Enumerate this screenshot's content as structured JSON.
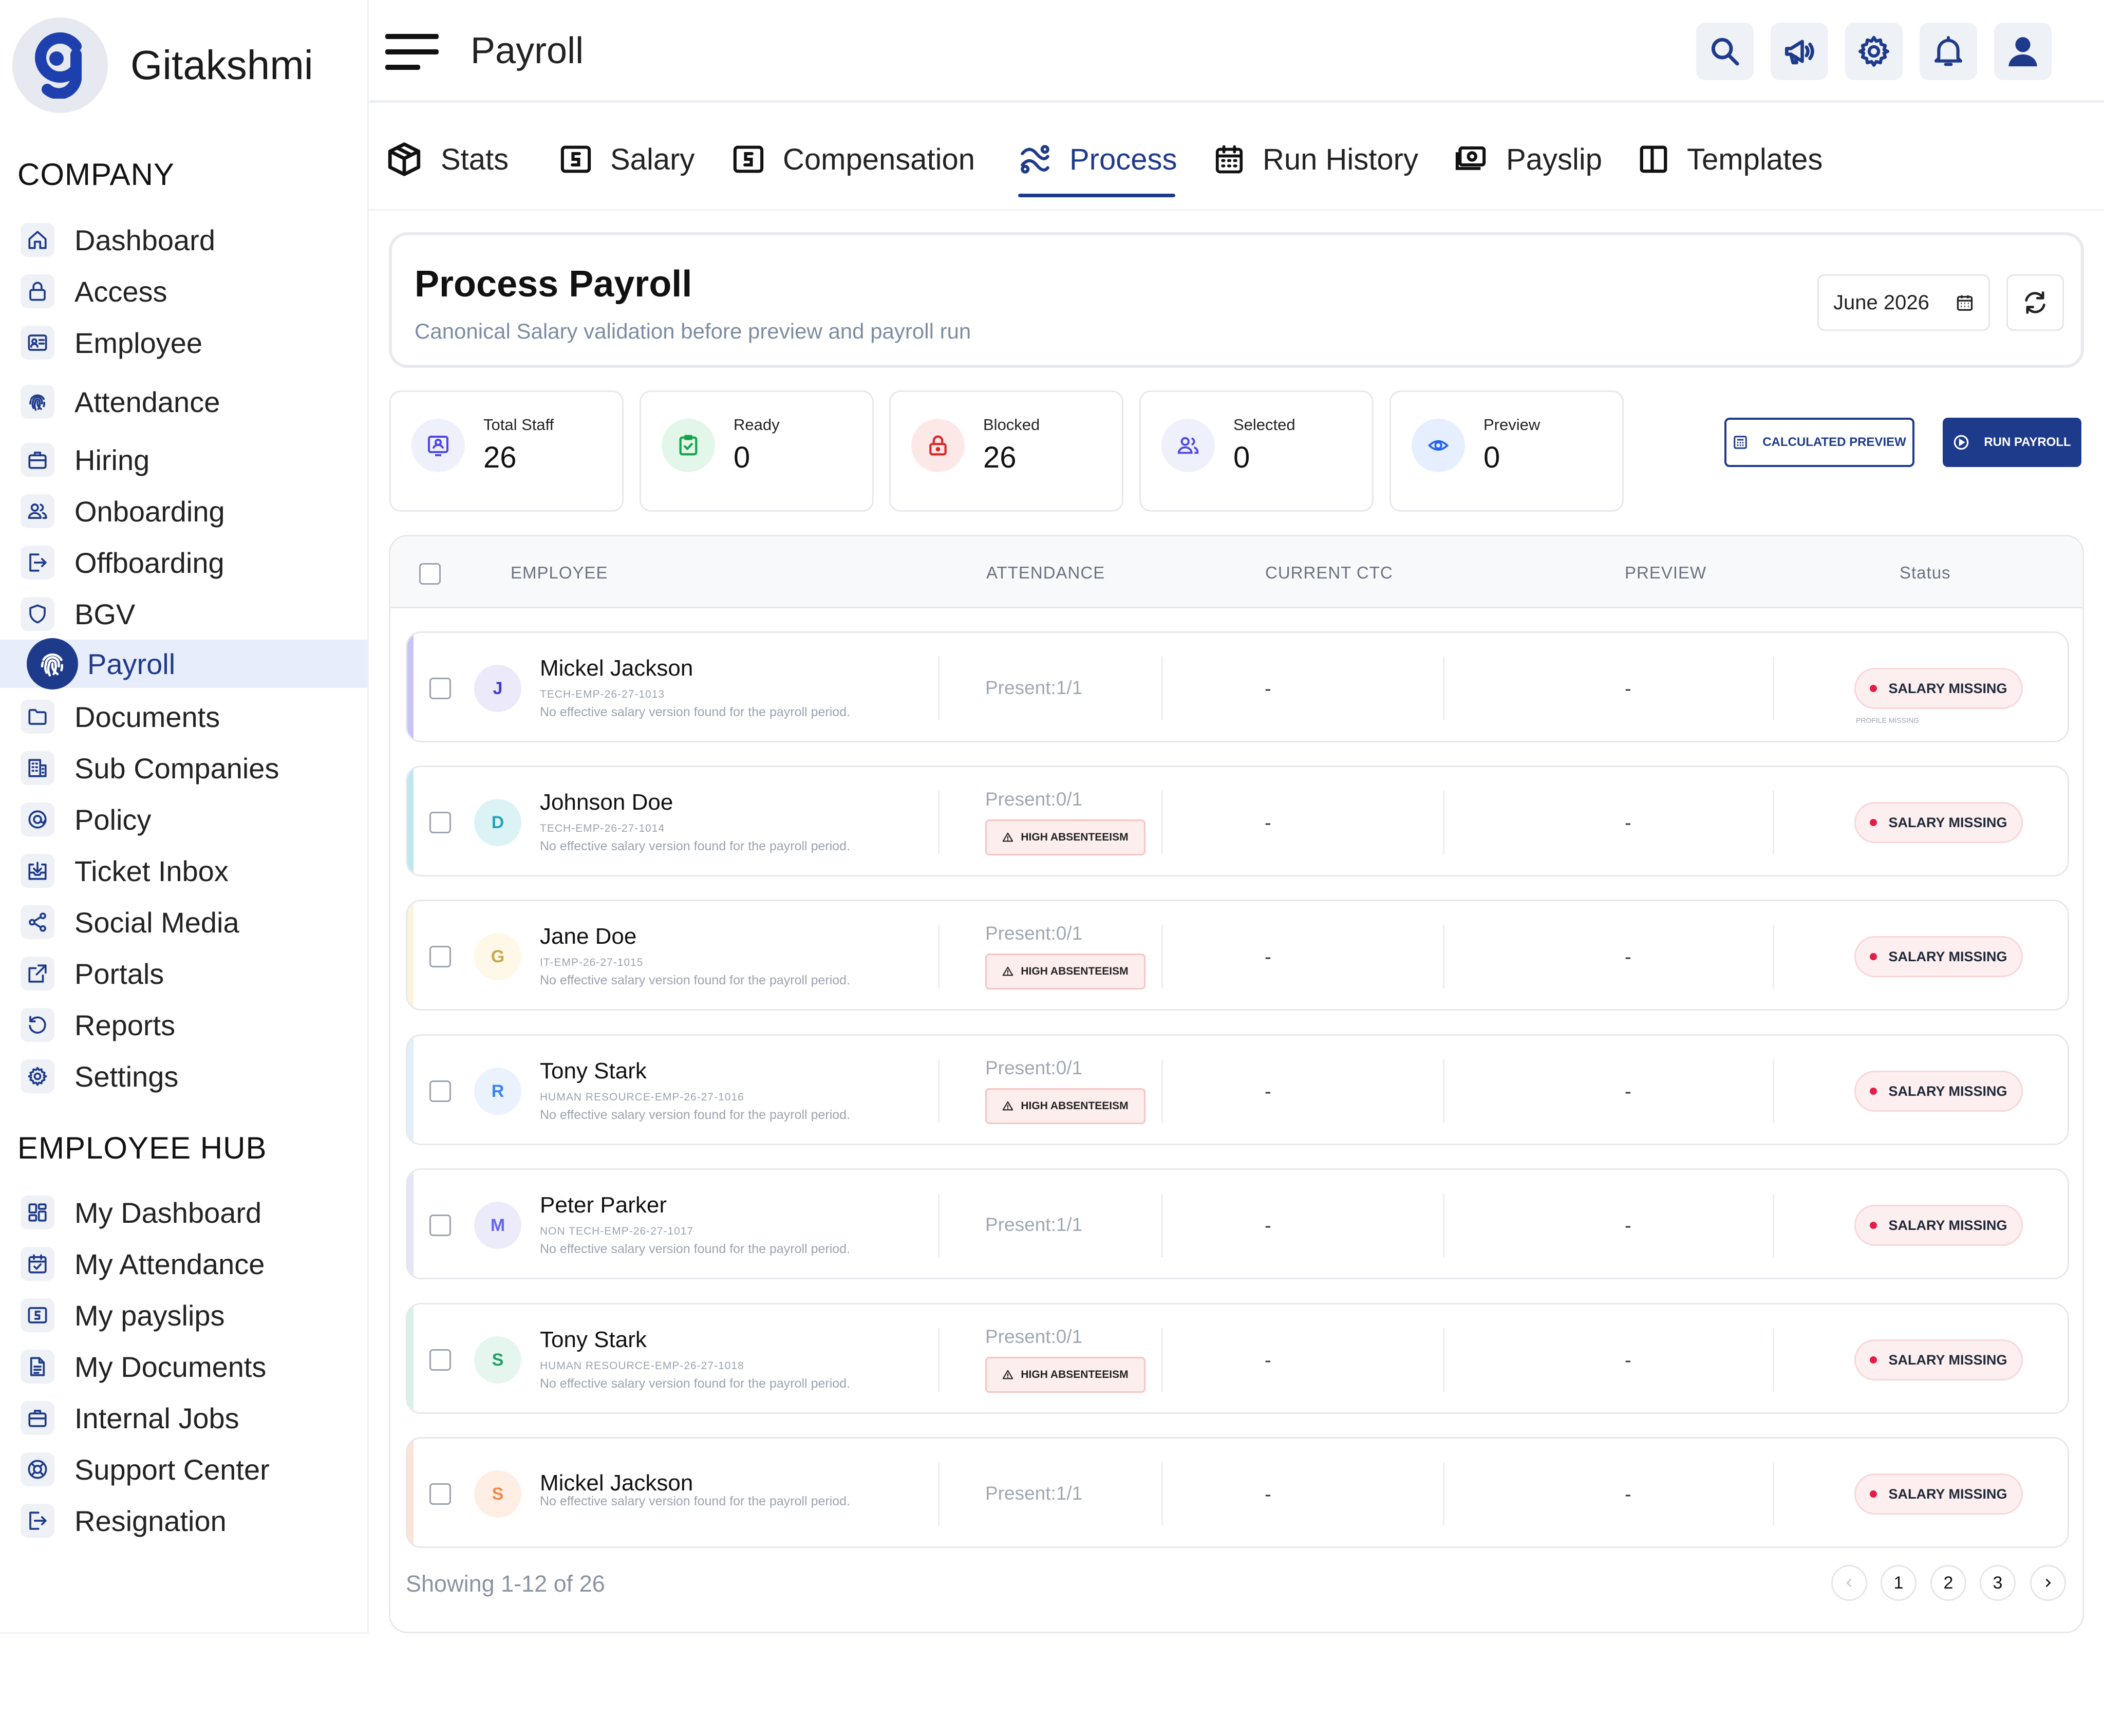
{
  "brand": {
    "name": "Gitakshmi"
  },
  "sidebar": {
    "company_title": "COMPANY",
    "company_items": [
      {
        "label": "Dashboard",
        "icon": "home-icon"
      },
      {
        "label": "Access",
        "icon": "lock-icon"
      },
      {
        "label": "Employee",
        "icon": "id-card-icon"
      },
      {
        "label": "Attendance",
        "icon": "fingerprint-icon"
      },
      {
        "label": "Hiring",
        "icon": "briefcase-icon"
      },
      {
        "label": "Onboarding",
        "icon": "users-icon"
      },
      {
        "label": "Offboarding",
        "icon": "logout-icon"
      },
      {
        "label": "BGV",
        "icon": "shield-icon"
      },
      {
        "label": "Payroll",
        "icon": "fingerprint-icon",
        "active": true
      },
      {
        "label": "Documents",
        "icon": "folder-icon"
      },
      {
        "label": "Sub Companies",
        "icon": "building-icon"
      },
      {
        "label": "Policy",
        "icon": "policy-icon"
      },
      {
        "label": "Ticket Inbox",
        "icon": "inbox-icon"
      },
      {
        "label": "Social Media",
        "icon": "share-icon"
      },
      {
        "label": "Portals",
        "icon": "external-link-icon"
      },
      {
        "label": "Reports",
        "icon": "refresh-icon"
      },
      {
        "label": "Settings",
        "icon": "gear-icon"
      }
    ],
    "hub_title": "EMPLOYEE HUB",
    "hub_items": [
      {
        "label": "My Dashboard",
        "icon": "grid-icon"
      },
      {
        "label": "My Attendance",
        "icon": "calendar-check-icon"
      },
      {
        "label": "My payslips",
        "icon": "payslip-icon"
      },
      {
        "label": "My Documents",
        "icon": "document-icon"
      },
      {
        "label": "Internal Jobs",
        "icon": "briefcase-icon"
      },
      {
        "label": "Support Center",
        "icon": "lifebuoy-icon"
      },
      {
        "label": "Resignation",
        "icon": "logout-icon"
      }
    ]
  },
  "header": {
    "title": "Payroll",
    "actions": [
      "search-icon",
      "megaphone-icon",
      "gear-icon",
      "bell-icon",
      "user-icon"
    ]
  },
  "tabs": [
    {
      "label": "Stats",
      "icon": "cube-icon"
    },
    {
      "label": "Salary",
      "icon": "currency-box-icon"
    },
    {
      "label": "Compensation",
      "icon": "currency-box-icon"
    },
    {
      "label": "Process",
      "icon": "process-icon",
      "active": true
    },
    {
      "label": "Run History",
      "icon": "calendar-icon"
    },
    {
      "label": "Payslip",
      "icon": "money-icon"
    },
    {
      "label": "Templates",
      "icon": "columns-icon"
    }
  ],
  "process_card": {
    "title": "Process Payroll",
    "subtitle": "Canonical Salary validation before preview and payroll run",
    "month": "June 2026"
  },
  "stats": [
    {
      "label": "Total Staff",
      "value": "26",
      "icon": "staff-icon",
      "color": "#4f46e5",
      "bg": "#eef0fc"
    },
    {
      "label": "Ready",
      "value": "0",
      "icon": "check-clipboard-icon",
      "color": "#16a34a",
      "bg": "#e3f6ea"
    },
    {
      "label": "Blocked",
      "value": "26",
      "icon": "lock-icon",
      "color": "#dc2626",
      "bg": "#fde8e8"
    },
    {
      "label": "Selected",
      "value": "0",
      "icon": "users-icon",
      "color": "#4f46e5",
      "bg": "#eef0fc"
    },
    {
      "label": "Preview",
      "value": "0",
      "icon": "eye-icon",
      "color": "#2563eb",
      "bg": "#e6efff"
    }
  ],
  "actions": {
    "calculated_preview": "CALCULATED PREVIEW",
    "run_payroll": "RUN PAYROLL"
  },
  "table": {
    "columns": [
      "EMPLOYEE",
      "ATTENDANCE",
      "CURRENT CTC",
      "PREVIEW",
      "Status"
    ],
    "rows": [
      {
        "initial": "J",
        "name": "Mickel Jackson",
        "code": "TECH-EMP-26-27-1013",
        "note": "No effective salary version found for the payroll period.",
        "attendance": "Present:1/1",
        "absenteeism": "",
        "ctc": "-",
        "preview": "-",
        "status": "SALARY MISSING",
        "sub_status": "PROFILE MISSING",
        "accent": "#c7c3f3",
        "avatar_bg": "#ece9fb",
        "avatar_fg": "#4338ca"
      },
      {
        "initial": "D",
        "name": "Johnson Doe",
        "code": "TECH-EMP-26-27-1014",
        "note": "No effective salary version found for the payroll period.",
        "attendance": "Present:0/1",
        "absenteeism": "HIGH ABSENTEEISM",
        "ctc": "-",
        "preview": "-",
        "status": "SALARY MISSING",
        "sub_status": "",
        "accent": "#bfe8ee",
        "avatar_bg": "#dcf3f6",
        "avatar_fg": "#22a5b8"
      },
      {
        "initial": "G",
        "name": "Jane Doe",
        "code": "IT-EMP-26-27-1015",
        "note": "No effective salary version found for the payroll period.",
        "attendance": "Present:0/1",
        "absenteeism": "HIGH ABSENTEEISM",
        "ctc": "-",
        "preview": "-",
        "status": "SALARY MISSING",
        "sub_status": "",
        "accent": "#fbf3dc",
        "avatar_bg": "#fdf8e8",
        "avatar_fg": "#c9a74a"
      },
      {
        "initial": "R",
        "name": "Tony Stark",
        "code": "HUMAN RESOURCE-EMP-26-27-1016",
        "note": "No effective salary version found for the payroll period.",
        "attendance": "Present:0/1",
        "absenteeism": "HIGH ABSENTEEISM",
        "ctc": "-",
        "preview": "-",
        "status": "SALARY MISSING",
        "sub_status": "",
        "accent": "#e3eefb",
        "avatar_bg": "#eaf3fd",
        "avatar_fg": "#3b82f6"
      },
      {
        "initial": "M",
        "name": "Peter Parker",
        "code": "NON TECH-EMP-26-27-1017",
        "note": "No effective salary version found for the payroll period.",
        "attendance": "Present:1/1",
        "absenteeism": "",
        "ctc": "-",
        "preview": "-",
        "status": "SALARY MISSING",
        "sub_status": "",
        "accent": "#e5e5f7",
        "avatar_bg": "#ecebfa",
        "avatar_fg": "#6366f1"
      },
      {
        "initial": "S",
        "name": "Tony Stark",
        "code": "HUMAN RESOURCE-EMP-26-27-1018",
        "note": "No effective salary version found for the payroll period.",
        "attendance": "Present:0/1",
        "absenteeism": "HIGH ABSENTEEISM",
        "ctc": "-",
        "preview": "-",
        "status": "SALARY MISSING",
        "sub_status": "",
        "accent": "#d9f2e6",
        "avatar_bg": "#e5f6ee",
        "avatar_fg": "#22a06b"
      },
      {
        "initial": "S",
        "name": "Mickel Jackson",
        "code": "",
        "note": "No effective salary version found for the payroll period.",
        "attendance": "Present:1/1",
        "absenteeism": "",
        "ctc": "-",
        "preview": "-",
        "status": "SALARY MISSING",
        "sub_status": "",
        "accent": "#fde4d6",
        "avatar_bg": "#feeee4",
        "avatar_fg": "#f08a4b"
      }
    ]
  },
  "pagination": {
    "summary": "Showing 1-12 of 26",
    "pages": [
      "1",
      "2",
      "3"
    ]
  }
}
